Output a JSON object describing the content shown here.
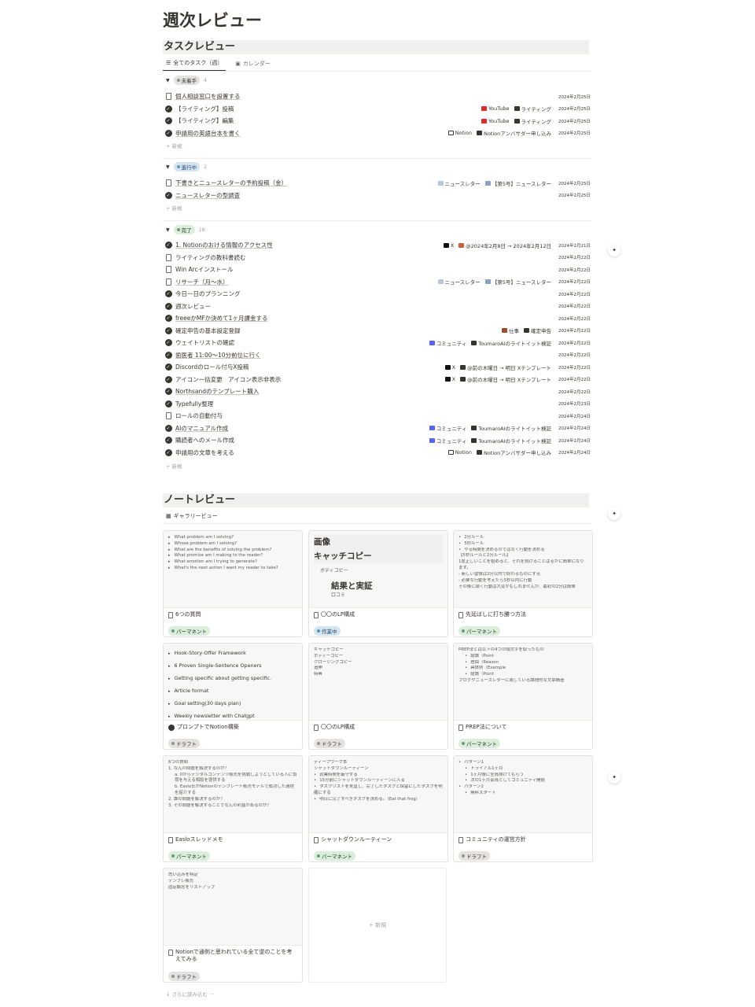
{
  "page": {
    "title": "週次レビュー"
  },
  "task_review": {
    "header": "タスクレビュー",
    "tabs": [
      {
        "label": "全てのタスク（週）"
      },
      {
        "label": "カレンダー"
      }
    ],
    "new_label": "+ 新規",
    "groups": [
      {
        "status": "未着手",
        "count": "4",
        "pill_color": "#e3e2e0",
        "rows": [
          {
            "title": "個人相談窓口を設置する",
            "icon": "doc-icon",
            "props": [],
            "date": "2024年2月25日"
          },
          {
            "title": "【ライティング】投稿",
            "icon": "check-icon",
            "props": [
              {
                "icon": "youtube-icon",
                "label": "YouTube"
              },
              {
                "icon": "folder-icon",
                "label": "ライティング"
              }
            ],
            "date": "2024年2月25日"
          },
          {
            "title": "【ライティング】編集",
            "icon": "check-icon",
            "props": [
              {
                "icon": "youtube-icon",
                "label": "YouTube"
              },
              {
                "icon": "folder-icon",
                "label": "ライティング"
              }
            ],
            "date": "2024年2月25日"
          },
          {
            "title": "申請用の英語台本を書く",
            "icon": "check-icon",
            "props": [
              {
                "icon": "notion-icon",
                "label": "Notion"
              },
              {
                "icon": "folder-icon",
                "label": "Notionアンバサダー申し込み"
              }
            ],
            "date": "2024年2月25日"
          }
        ]
      },
      {
        "status": "進行中",
        "count": "2",
        "pill_color": "#d3e5ef",
        "rows": [
          {
            "title": "下書きとニュースレターの予約投稿（金）",
            "icon": "doc-icon",
            "props": [
              {
                "icon": "mail-icon",
                "label": "ニュースレター"
              },
              {
                "icon": "page-icon",
                "label": "【第5号】ニュースレター"
              }
            ],
            "date": "2024年2月25日"
          },
          {
            "title": "ニュースレターの型調査",
            "icon": "check-icon",
            "props": [],
            "date": "2024年2月25日"
          }
        ]
      },
      {
        "status": "完了",
        "count": "18",
        "pill_color": "#dbeddb",
        "rows": [
          {
            "title": "1. Notionのおける情報のアクセス性",
            "icon": "check-icon",
            "props": [
              {
                "icon": "x-icon",
                "label": "X"
              },
              {
                "icon": "pin-icon",
                "label": "@2024年2月8日 → 2024年2月12日"
              }
            ],
            "date": "2024年2月21日"
          },
          {
            "title": "ライティングの教科書読む",
            "icon": "doc-icon",
            "props": [],
            "date": "2024年2月22日"
          },
          {
            "title": "Win Arcインストール",
            "icon": "doc-icon",
            "props": [],
            "date": "2024年2月22日"
          },
          {
            "title": "リサーチ（月〜水）",
            "icon": "doc-icon",
            "props": [
              {
                "icon": "mail-icon",
                "label": "ニュースレター"
              },
              {
                "icon": "page-icon",
                "label": "【第5号】ニュースレター"
              }
            ],
            "date": "2024年2月22日"
          },
          {
            "title": "今日一日のプランニング",
            "icon": "check-icon",
            "props": [],
            "date": "2024年2月22日"
          },
          {
            "title": "週次レビュー",
            "icon": "check-icon",
            "props": [],
            "date": "2024年2月22日"
          },
          {
            "title": "freeeかMFか決めて1ヶ月課金する",
            "icon": "check-icon",
            "props": [],
            "date": "2024年2月22日"
          },
          {
            "title": "確定申告の基本設定登録",
            "icon": "check-icon",
            "props": [
              {
                "icon": "briefcase-icon",
                "label": "仕事"
              },
              {
                "icon": "folder-icon",
                "label": "確定申告"
              }
            ],
            "date": "2024年2月22日"
          },
          {
            "title": "ウェイトリストの確認",
            "icon": "check-icon",
            "props": [
              {
                "icon": "discord-icon",
                "label": "コミュニティ"
              },
              {
                "icon": "folder-icon",
                "label": "ToumaroAIのライトイット検証"
              }
            ],
            "date": "2024年2月22日"
          },
          {
            "title": "歯医者 11:00〜10分前位に行く",
            "icon": "check-icon",
            "props": [],
            "date": "2024年2月22日"
          },
          {
            "title": "Discordのロール付与X投稿",
            "icon": "check-icon",
            "props": [
              {
                "icon": "x-icon",
                "label": "X"
              },
              {
                "icon": "folder-icon",
                "label": "@前の木曜日 → 明日 Xテンプレート"
              }
            ],
            "date": "2024年2月22日"
          },
          {
            "title": "アイコン一括変更　アイコン表示非表示",
            "icon": "check-icon",
            "props": [
              {
                "icon": "x-icon",
                "label": "X"
              },
              {
                "icon": "folder-icon",
                "label": "@前の木曜日 → 明日 Xテンプレート"
              }
            ],
            "date": "2024年2月22日"
          },
          {
            "title": "Northsandのテンプレート購入",
            "icon": "check-icon",
            "props": [],
            "date": "2024年2月22日"
          },
          {
            "title": "Typefully整理",
            "icon": "check-icon",
            "props": [],
            "date": "2024年2月23日"
          },
          {
            "title": "ロールの自動付与",
            "icon": "doc-icon",
            "props": [],
            "date": "2024年2月24日"
          },
          {
            "title": "AIのマニュアル作成",
            "icon": "check-icon",
            "props": [
              {
                "icon": "discord-icon",
                "label": "コミュニティ"
              },
              {
                "icon": "folder-icon",
                "label": "ToumaroAIのライトイット検証"
              }
            ],
            "date": "2024年2月24日"
          },
          {
            "title": "購読者へのメール作成",
            "icon": "check-icon",
            "props": [
              {
                "icon": "discord-icon",
                "label": "コミュニティ"
              },
              {
                "icon": "folder-icon",
                "label": "ToumaroAIのライトイット検証"
              }
            ],
            "date": "2024年2月24日"
          },
          {
            "title": "申請用の文章を考える",
            "icon": "check-icon",
            "props": [
              {
                "icon": "notion-icon",
                "label": "Notion"
              },
              {
                "icon": "folder-icon",
                "label": "Notionアンバサダー申し込み"
              }
            ],
            "date": "2024年2月24日"
          }
        ]
      }
    ]
  },
  "note_review": {
    "header": "ノートレビュー",
    "tab": "ギャラリービュー",
    "new_label": "+ 新規",
    "load_more": "↓ さらに読み込む ···",
    "cards": [
      {
        "title": "6つの質問",
        "tag": "パーマネント",
        "tag_type": "green",
        "icon": "doc-icon",
        "preview": [
          "What problem am I solving?",
          "Whose problem am I solving?",
          "What are the benefits of solving the problem?",
          "What promise am I making to the reader?",
          "What emotion am I trying to generate?",
          "What's the next action I want my reader to take?"
        ]
      },
      {
        "title": "〇〇のLP構成",
        "tag": "作業中",
        "tag_type": "blue",
        "icon": "doc-icon",
        "preview": [
          "画像",
          "キャッチコピー",
          "ボディコピー",
          "結果と実証",
          "口コミ"
        ]
      },
      {
        "title": "先延ばしに打ち勝つ方法",
        "tag": "パーマネント",
        "tag_type": "green",
        "icon": "doc-icon",
        "preview": [
          "2分ルール",
          "5秒ルール",
          "やる時間を決めるのではなく行動を決める",
          "【5秒ルールと2分ルール】",
          "1度正しいことを始めると、それを続けることはるかに簡単になります。",
          "- 新しい習慣は2分以内で終わるものにする",
          "- 必要な行動を考えたら5秒以内に行動",
          "その後に続く行動は大変かもしれませんが、最初の2分は簡単"
        ]
      },
      {
        "title": "プロンプトでNotion構築",
        "tag": "ドラフト",
        "tag_type": "gray",
        "icon": "check-icon",
        "preview": [
          "Hook-Story-Offer Framework",
          "6 Proven Single-Sentence Openers",
          "Getting specific about getting specific.",
          "Article format",
          "Goal setting(30 days plan)",
          "Weekly newsletter with Chatgpt"
        ]
      },
      {
        "title": "〇〇のLP構成",
        "tag": "ドラフト",
        "tag_type": "gray",
        "icon": "doc-icon",
        "preview": [
          "キャッチコピー",
          "ボディーコピー",
          "クロージングコピー",
          "追伸",
          "特典"
        ]
      },
      {
        "title": "PREP法について",
        "tag": "パーマネント",
        "tag_type": "green",
        "icon": "doc-icon",
        "preview": [
          "PREP法とは以下の4つの頭文字を取ったもの",
          "結論（Point",
          "理由（Reason",
          "具体例（Example",
          "結論（Point",
          "ブログやニュースレターに適している論理的な文章構造"
        ]
      },
      {
        "title": "Easloスレッドメモ",
        "tag": "パーマネント",
        "tag_type": "green",
        "icon": "doc-icon",
        "preview": [
          "6つの質問",
          "1.  なんの問題を解決するのか？",
          "a.  0からデジタルコンテンツ販売を挑戦しようとしている人に負荷を与える相談を提供する",
          "b.  Easlo氏がNotionのテンプレート販売モデルで成功した過程を紹介する",
          "2.  誰の問題を解決するのか？",
          "3.  その問題を解決することでなんの利益があるのか？"
        ]
      },
      {
        "title": "シャットダウンルーティーン",
        "tag": "パーマネント",
        "tag_type": "green",
        "icon": "doc-icon",
        "preview": [
          "ディープワーク本",
          "シャットダウンルーティーン",
          "就業時間を厳守する",
          "15分前にシャットダウンルーティーンに入る",
          "タスクリストを見直し、完了したタスクと保留にしたタスクを明確にする",
          "明日に完了すべきタスクを決める。（Eat that frog）"
        ]
      },
      {
        "title": "コミュニティの運営方針",
        "tag": "ドラフト",
        "tag_type": "gray",
        "icon": "doc-icon",
        "preview": [
          "パターン1",
          "トライアル1ヶ月",
          "1ヶ月後に全員排けてもらう",
          "次の1ヶ月会員としてコミュニティ開始",
          "パターン2",
          "無料スタート"
        ]
      },
      {
        "title": "Notionで通例と思われている全て逆のことを考えてみる",
        "tag": "ドラフト",
        "tag_type": "gray",
        "icon": "doc-icon",
        "preview": [
          "思い込みを特定",
          "テンプレ販売",
          "固定観念をリストアップ"
        ]
      }
    ]
  },
  "colors": {
    "green_pill": "#dbeddb",
    "blue_pill": "#d3e5ef",
    "gray_pill": "#e3e2e0",
    "youtube": "#e02a2a",
    "discord": "#5865f2"
  }
}
